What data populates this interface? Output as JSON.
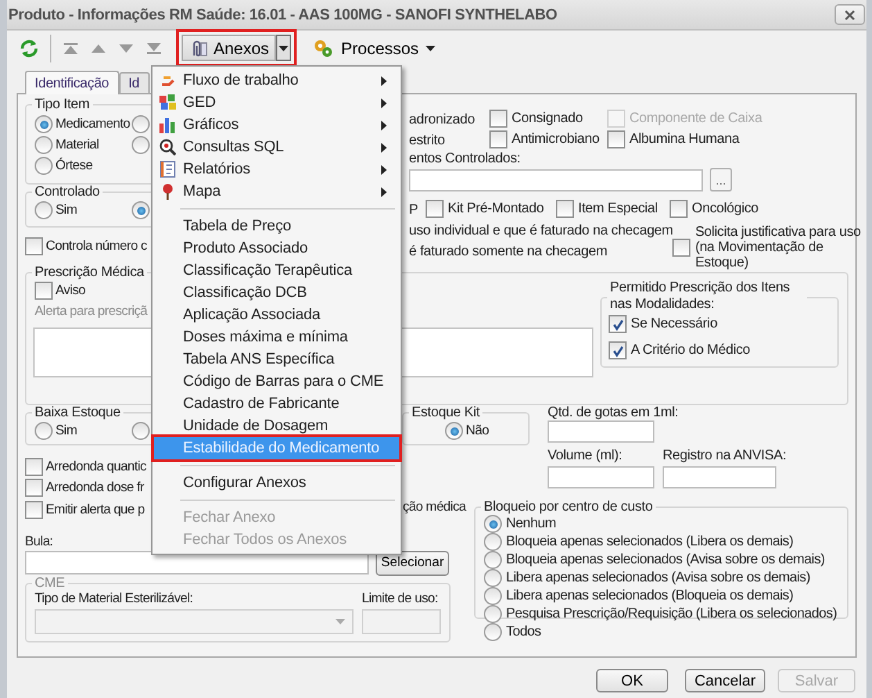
{
  "window": {
    "title": "Produto - Informações RM Saúde: 16.01 - AAS 100MG - SANOFI SYNTHELABO"
  },
  "toolbar": {
    "anexos": {
      "label": "Anexos",
      "highlighted": true
    },
    "processos": {
      "label": "Processos"
    }
  },
  "tabs": [
    {
      "label": "Identificação",
      "selected": true
    },
    {
      "label": "Id",
      "selected": false
    }
  ],
  "tipo_item": {
    "title": "Tipo Item",
    "options": [
      {
        "label": "Medicamento",
        "selected": true
      },
      {
        "label": "Material",
        "selected": false
      },
      {
        "label": "Órtese",
        "selected": false
      }
    ],
    "hidden_options": [
      {
        "selected": false
      },
      {
        "selected": false
      }
    ]
  },
  "flag_rows": [
    [
      {
        "kind": "text",
        "label": "adronizado"
      },
      {
        "kind": "checkbox",
        "label": "Consignado",
        "checked": false,
        "disabled": false
      },
      {
        "kind": "checkbox",
        "label": "Componente de Caixa",
        "checked": false,
        "disabled": true
      }
    ],
    [
      {
        "kind": "text",
        "label": "estrito"
      },
      {
        "kind": "checkbox",
        "label": "Antimicrobiano",
        "checked": false,
        "disabled": false
      },
      {
        "kind": "checkbox",
        "label": "Albumina Humana",
        "checked": false,
        "disabled": false
      }
    ]
  ],
  "controlados": {
    "label": "entos Controlados:",
    "button": "..."
  },
  "controlado": {
    "title": "Controlado",
    "options": [
      {
        "label": "Sim",
        "selected": false
      },
      {
        "selected": true
      }
    ]
  },
  "flag_row_3": [
    {
      "kind": "text",
      "label": "P"
    },
    {
      "kind": "checkbox",
      "label": "Kit Pré-Montado",
      "checked": false,
      "disabled": false
    },
    {
      "kind": "checkbox",
      "label": "Item Especial",
      "checked": false,
      "disabled": false
    },
    {
      "kind": "checkbox",
      "label": "Oncológico",
      "checked": false,
      "disabled": false
    }
  ],
  "faturamento": [
    "uso individual e que é faturado na checagem",
    "é faturado somente na checagem"
  ],
  "solicita": {
    "label": "Solicita justificativa para uso (na Movimentação de Estoque)",
    "checked": false
  },
  "controla_numero": {
    "label": "Controla número c",
    "checked": false
  },
  "prescricao": {
    "title": "Prescrição Médica",
    "aviso": {
      "label": "Aviso",
      "checked": false
    },
    "alerta_label": "Alerta para prescriçã"
  },
  "permitido": {
    "title": "Permitido Prescrição dos Itens nas Modalidades:",
    "options": [
      {
        "label": "Se Necessário",
        "checked": true
      },
      {
        "label": "A Critério do Médico",
        "checked": true
      }
    ]
  },
  "baixa_estoque": {
    "title": "Baixa Estoque",
    "options": [
      {
        "label": "Sim",
        "selected": false
      },
      {
        "selected": false
      }
    ]
  },
  "estoque_kit": {
    "title": "Estoque Kit",
    "options": [
      {
        "label": "Não",
        "selected": true
      }
    ]
  },
  "qtd_gotas": {
    "label": "Qtd. de gotas em 1ml:"
  },
  "volume": {
    "label": "Volume (ml):"
  },
  "registro": {
    "label": "Registro na ANVISA:"
  },
  "checks": [
    {
      "label": "Arredonda quantic",
      "checked": false
    },
    {
      "label": "Arredonda dose fr",
      "checked": false
    },
    {
      "label": "Emitir alerta que p",
      "checked": false,
      "tail": "ção médica"
    }
  ],
  "bula": {
    "label": "Bula:",
    "button": "Selecionar"
  },
  "cme": {
    "title": "CME",
    "tipo_label": "Tipo de Material Esterilizável:",
    "limite_label": "Limite de uso:"
  },
  "bloqueio": {
    "title": "Bloqueio por centro de custo",
    "options": [
      {
        "label": "Nenhum",
        "selected": true
      },
      {
        "label": "Bloqueia apenas selecionados (Libera os demais)",
        "selected": false
      },
      {
        "label": "Bloqueia apenas selecionados (Avisa sobre os demais)",
        "selected": false
      },
      {
        "label": "Libera apenas selecionados (Avisa sobre os demais)",
        "selected": false
      },
      {
        "label": "Libera apenas selecionados (Bloqueia os demais)",
        "selected": false
      },
      {
        "label": "Pesquisa Prescrição/Requisição (Libera os selecionados)",
        "selected": false
      },
      {
        "label": "Todos",
        "selected": false
      }
    ]
  },
  "buttons": [
    {
      "label": "OK",
      "disabled": false
    },
    {
      "label": "Cancelar",
      "disabled": false
    },
    {
      "label": "Salvar",
      "disabled": true
    }
  ],
  "menu": [
    {
      "kind": "item",
      "label": "Fluxo de trabalho",
      "submenu": true,
      "disabled": false,
      "selected": false,
      "highlighted": false
    },
    {
      "kind": "item",
      "label": "GED",
      "submenu": true,
      "disabled": false,
      "selected": false,
      "highlighted": false
    },
    {
      "kind": "item",
      "label": "Gráficos",
      "submenu": true,
      "disabled": false,
      "selected": false,
      "highlighted": false
    },
    {
      "kind": "item",
      "label": "Consultas SQL",
      "submenu": true,
      "disabled": false,
      "selected": false,
      "highlighted": false
    },
    {
      "kind": "item",
      "label": "Relatórios",
      "submenu": true,
      "disabled": false,
      "selected": false,
      "highlighted": false
    },
    {
      "kind": "item",
      "label": "Mapa",
      "submenu": true,
      "disabled": false,
      "selected": false,
      "highlighted": false
    },
    {
      "kind": "separator"
    },
    {
      "kind": "item",
      "label": "Tabela de Preço",
      "submenu": false,
      "disabled": false,
      "selected": false,
      "highlighted": false
    },
    {
      "kind": "item",
      "label": "Produto Associado",
      "submenu": false,
      "disabled": false,
      "selected": false,
      "highlighted": false
    },
    {
      "kind": "item",
      "label": "Classificação Terapêutica",
      "submenu": false,
      "disabled": false,
      "selected": false,
      "highlighted": false
    },
    {
      "kind": "item",
      "label": "Classificação DCB",
      "submenu": false,
      "disabled": false,
      "selected": false,
      "highlighted": false
    },
    {
      "kind": "item",
      "label": "Aplicação Associada",
      "submenu": false,
      "disabled": false,
      "selected": false,
      "highlighted": false
    },
    {
      "kind": "item",
      "label": "Doses máxima e mínima",
      "submenu": false,
      "disabled": false,
      "selected": false,
      "highlighted": false
    },
    {
      "kind": "item",
      "label": "Tabela ANS Específica",
      "submenu": false,
      "disabled": false,
      "selected": false,
      "highlighted": false
    },
    {
      "kind": "item",
      "label": "Código de Barras para o CME",
      "submenu": false,
      "disabled": false,
      "selected": false,
      "highlighted": false
    },
    {
      "kind": "item",
      "label": "Cadastro de Fabricante",
      "submenu": false,
      "disabled": false,
      "selected": false,
      "highlighted": false
    },
    {
      "kind": "item",
      "label": "Unidade de Dosagem",
      "submenu": false,
      "disabled": false,
      "selected": false,
      "highlighted": false
    },
    {
      "kind": "item",
      "label": "Estabilidade do Medicamento",
      "submenu": false,
      "disabled": false,
      "selected": true,
      "highlighted": true
    },
    {
      "kind": "separator"
    },
    {
      "kind": "item",
      "label": "Configurar Anexos",
      "submenu": false,
      "disabled": false,
      "selected": false,
      "highlighted": false
    },
    {
      "kind": "separator"
    },
    {
      "kind": "item",
      "label": "Fechar Anexo",
      "submenu": false,
      "disabled": true,
      "selected": false,
      "highlighted": false
    },
    {
      "kind": "item",
      "label": "Fechar Todos os Anexos",
      "submenu": false,
      "disabled": true,
      "selected": false,
      "highlighted": false
    }
  ]
}
